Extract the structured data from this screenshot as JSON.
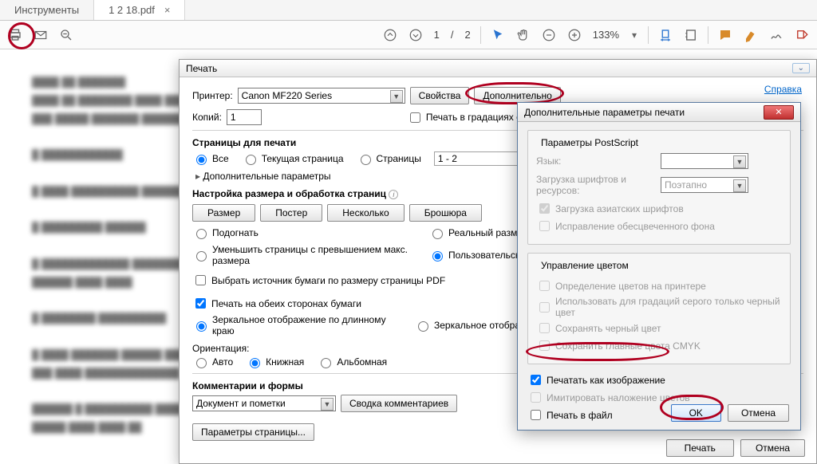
{
  "tabs": {
    "tools": "Инструменты",
    "file": "1 2 18.pdf"
  },
  "toolbar": {
    "page_cur": "1",
    "page_sep": "/",
    "page_total": "2",
    "zoom": "133%"
  },
  "icons": {
    "print": "print",
    "mail": "mail",
    "zoomout": "zoom-out",
    "up": "arrow-up",
    "down": "arrow-down",
    "cursor": "cursor",
    "hand": "hand",
    "minus": "minus",
    "plus": "plus",
    "dd": "dd",
    "fitw": "fit-width",
    "fitp": "fit-page",
    "note": "note",
    "highlight": "highlight",
    "sign": "sign",
    "stamp": "stamp"
  },
  "printdlg": {
    "title": "Печать",
    "printer_label": "Принтер:",
    "printer_value": "Canon MF220 Series",
    "properties": "Свойства",
    "advanced": "Дополнительно",
    "help": "Справка",
    "copies_label": "Копий:",
    "copies_value": "1",
    "grayscale": "Печать в градациях серого",
    "pages_title": "Страницы для печати",
    "p_all": "Все",
    "p_current": "Текущая страница",
    "p_range": "Страницы",
    "p_range_val": "1 - 2",
    "p_more": "Дополнительные параметры",
    "size_title": "Настройка размера и обработка страниц",
    "b_size": "Размер",
    "b_poster": "Постер",
    "b_multi": "Несколько",
    "b_booklet": "Брошюра",
    "s_fit": "Подогнать",
    "s_actual": "Реальный размер",
    "s_shrink": "Уменьшить страницы с превышением макс. размера",
    "s_custom": "Пользовательский масштаб",
    "src_by_pdf": "Выбрать источник бумаги по размеру страницы PDF",
    "duplex": "Печать на обеих сторонах бумаги",
    "d_long": "Зеркальное отображение по длинному краю",
    "d_short": "Зеркальное отображение по короткому краю",
    "orient_title": "Ориентация:",
    "o_auto": "Авто",
    "o_port": "Книжная",
    "o_land": "Альбомная",
    "comments_title": "Комментарии и формы",
    "comments_val": "Документ и пометки",
    "comments_btn": "Сводка комментариев",
    "page_setup": "Параметры страницы...",
    "ok": "Печать",
    "cancel": "Отмена"
  },
  "advdlg": {
    "title": "Дополнительные параметры печати",
    "ps_group": "Параметры PostScript",
    "lang": "Язык:",
    "font_load": "Загрузка шрифтов и ресурсов:",
    "font_load_val": "Поэтапно",
    "asian": "Загрузка азиатских шрифтов",
    "bg_fix": "Исправление обесцвеченного фона",
    "color_group": "Управление цветом",
    "c1": "Определение цветов на принтере",
    "c2": "Использовать для градаций серого только черный цвет",
    "c3": "Сохранять черный цвет",
    "c4": "Сохранить главные цвета CMYK",
    "as_image": "Печатать как изображение",
    "overprint": "Имитировать наложение цветов",
    "to_file": "Печать в файл",
    "ok": "OK",
    "cancel": "Отмена"
  }
}
